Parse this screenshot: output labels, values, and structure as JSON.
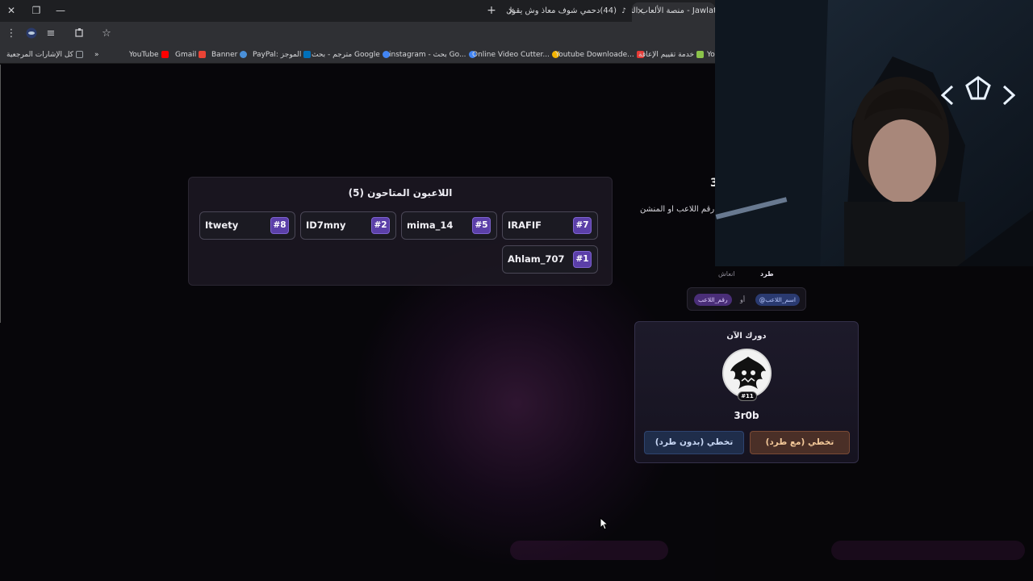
{
  "browser": {
    "tabs": [
      {
        "title": "Jawlat - منصة الألعاب التفاعلية",
        "active": true
      },
      {
        "title": "(44)دحمي شوف معاذ وش يقول",
        "active": false
      }
    ],
    "new_tab_label": "+",
    "close_label": "×",
    "window_controls": {
      "close": "✕",
      "restore": "❐",
      "minimize": "—"
    },
    "bookmarks": [
      {
        "label": "كل الإشارات المرجعية",
        "color": "#9aa0a6"
      },
      {
        "label": "YouTube",
        "color": "#ff0000"
      },
      {
        "label": "Gmail",
        "color": "#ea4335"
      },
      {
        "label": "Banner",
        "color": "#4a90d9"
      },
      {
        "label": "PayPal: الموجز",
        "color": "#0070ba"
      },
      {
        "label": "مترجم - بحث Google",
        "color": "#4285f4"
      },
      {
        "label": "instagram - بحث Go...",
        "color": "#4285f4"
      },
      {
        "label": "Online Video Cutter...",
        "color": "#f4b400"
      },
      {
        "label": "Youtube Downloade...",
        "color": "#e53935"
      },
      {
        "label": "خدمة تقييم الإعاقة",
        "color": "#8bc34a"
      },
      {
        "label": "Yo",
        "color": "#9aa0a6"
      }
    ],
    "bookmarks_more": "»"
  },
  "kicked_panel": {
    "title": "اللاعبون المتاحون (5)",
    "players": [
      {
        "name": "IRAFIF",
        "number": "#7"
      },
      {
        "name": "mima_14",
        "number": "#5"
      },
      {
        "name": "ID7mny",
        "number": "#2"
      },
      {
        "name": "Itwety",
        "number": "#8"
      },
      {
        "name": "Ahlam_707",
        "number": "#1"
      }
    ]
  },
  "side": {
    "partial_digit": "3",
    "hint_text": "رقم اللاعب او المنشن",
    "tab_kick": "طرد",
    "tab_revive": "انعاش",
    "pill_name": "@اسم_اللاعب",
    "pill_or": "أو",
    "pill_number": "رقم_اللاعب"
  },
  "turn_card": {
    "title": "دورك الآن",
    "badge": "#11",
    "player_name": "3r0b",
    "btn_kick": "تخطي (مع طرد)",
    "btn_no_kick": "تخطي (بدون طرد)"
  },
  "colors": {
    "accent_purple": "#5b3fa8",
    "kick_orange": "#f4c99a",
    "nokick_blue": "#c9d8f5"
  }
}
